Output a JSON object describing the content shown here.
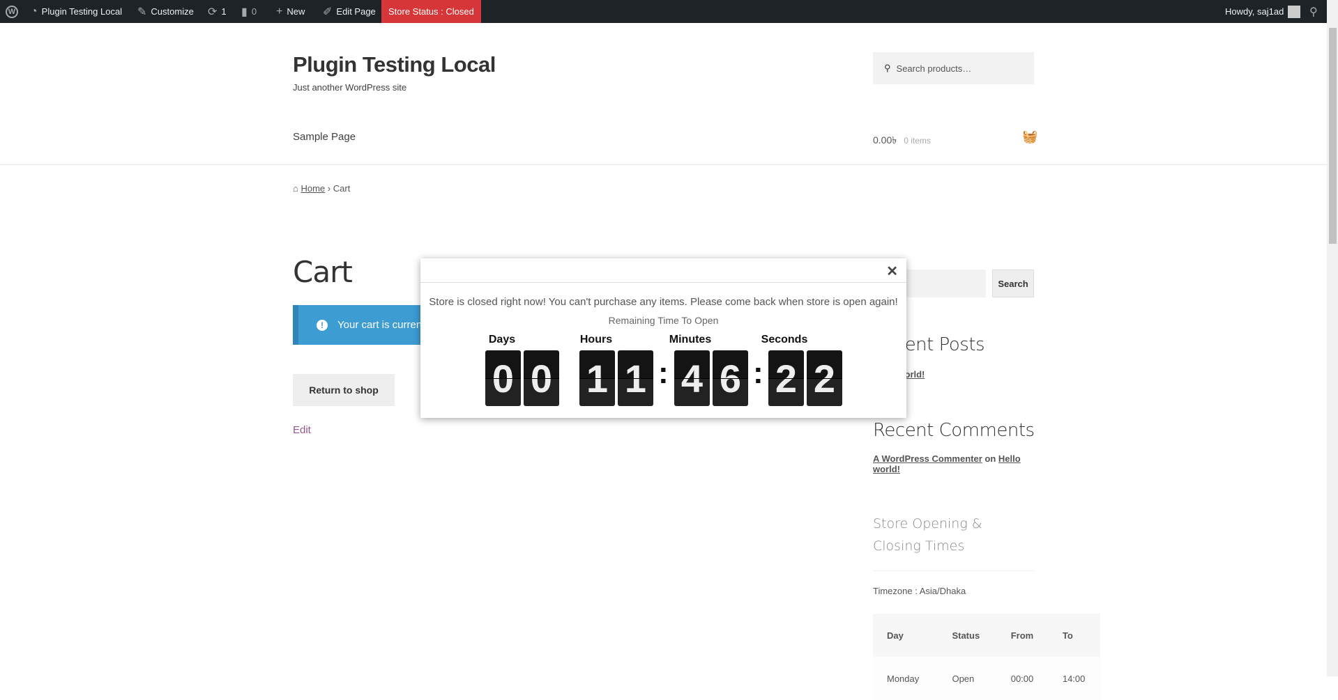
{
  "adminbar": {
    "site": "Plugin Testing Local",
    "customize": "Customize",
    "updates": "1",
    "comments": "0",
    "new": "New",
    "edit_page": "Edit Page",
    "store_status": "Store Status : Closed",
    "howdy": "Howdy, saj1ad",
    "store_status_color": "#d63638"
  },
  "header": {
    "title": "Plugin Testing Local",
    "tagline": "Just another WordPress site",
    "search_placeholder": "Search products…",
    "nav": [
      "Sample Page"
    ],
    "cart_total": "0.00৳",
    "cart_items": "0 items"
  },
  "breadcrumb": {
    "home": "Home",
    "current": "Cart"
  },
  "main": {
    "title": "Cart",
    "notice": "Your cart is currently empty.",
    "return_button": "Return to shop",
    "edit": "Edit",
    "notice_color": "#3d9cd2"
  },
  "sidebar": {
    "search_button": "Search",
    "recent_posts_title": "Recent Posts",
    "recent_post": "Hello world!",
    "recent_comments_title": "Recent Comments",
    "commenter": "A WordPress Commenter",
    "on": "on",
    "comment_post": "Hello world!",
    "store_times_title": "Store Opening & Closing Times",
    "timezone": "Timezone : Asia/Dhaka",
    "table": {
      "headers": [
        "Day",
        "Status",
        "From",
        "To"
      ],
      "rows": [
        [
          "Monday",
          "Open",
          "00:00",
          "14:00"
        ]
      ]
    }
  },
  "modal": {
    "message": "Store is closed right now! You can't purchase any items. Please come back when store is open again!",
    "remaining": "Remaining Time To Open",
    "labels": {
      "days": "Days",
      "hours": "Hours",
      "minutes": "Minutes",
      "seconds": "Seconds"
    },
    "digits": {
      "d1": "0",
      "d2": "0",
      "h1": "1",
      "h2": "1",
      "m1": "4",
      "m2": "6",
      "s1": "2",
      "s2": "2"
    },
    "colon": ":"
  }
}
